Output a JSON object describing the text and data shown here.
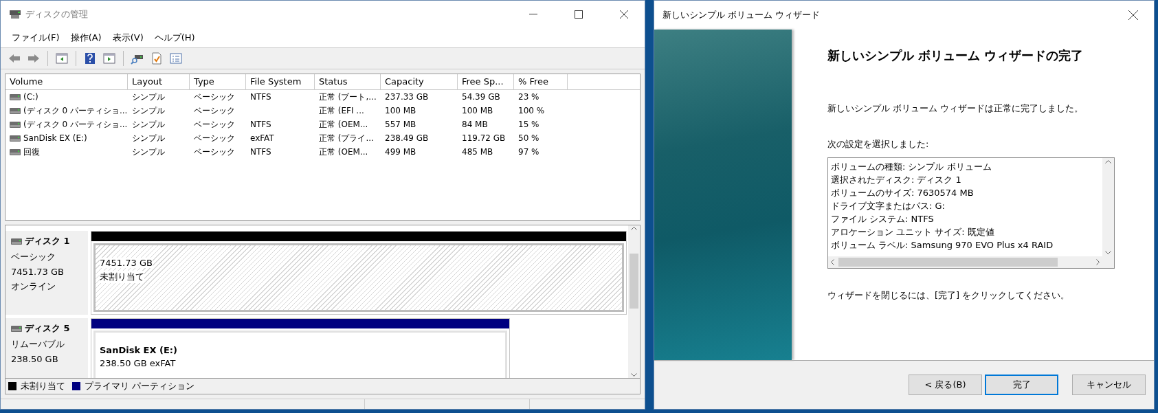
{
  "disk_management": {
    "title": "ディスクの管理",
    "menu": [
      "ファイル(F)",
      "操作(A)",
      "表示(V)",
      "ヘルプ(H)"
    ],
    "table": {
      "columns": [
        "Volume",
        "Layout",
        "Type",
        "File System",
        "Status",
        "Capacity",
        "Free Sp...",
        "% Free"
      ],
      "rows": [
        {
          "cells": [
            " (C:)",
            "シンプル",
            "ベーシック",
            "NTFS",
            "正常 (ブート,...",
            "237.33 GB",
            "54.39 GB",
            "23 %"
          ]
        },
        {
          "cells": [
            "(ディスク 0 パーティショ...",
            "シンプル",
            "ベーシック",
            "",
            "正常 (EFI ...",
            "100 MB",
            "100 MB",
            "100 %"
          ]
        },
        {
          "cells": [
            "(ディスク 0 パーティショ...",
            "シンプル",
            "ベーシック",
            "NTFS",
            "正常 (OEM...",
            "557 MB",
            "84 MB",
            "15 %"
          ]
        },
        {
          "cells": [
            "SanDisk EX (E:)",
            "シンプル",
            "ベーシック",
            "exFAT",
            "正常 (プライ...",
            "238.49 GB",
            "119.72 GB",
            "50 %"
          ]
        },
        {
          "cells": [
            "回復",
            "シンプル",
            "ベーシック",
            "NTFS",
            "正常 (OEM...",
            "499 MB",
            "485 MB",
            "97 %"
          ]
        }
      ]
    },
    "disks": [
      {
        "name": "ディスク 1",
        "lines": [
          "ベーシック",
          "7451.73 GB",
          "オンライン"
        ],
        "partitions": [
          {
            "kind": "unallocated",
            "color": "#000000",
            "lines": [
              "7451.73 GB",
              "未割り当て"
            ]
          }
        ]
      },
      {
        "name": "ディスク 5",
        "lines": [
          "リムーバブル",
          "238.50 GB"
        ],
        "partitions": [
          {
            "kind": "primary",
            "color": "#000080",
            "title": "SanDisk EX  (E:)",
            "lines": [
              "238.50 GB exFAT"
            ]
          }
        ]
      }
    ],
    "legend": [
      {
        "label": "未割り当て",
        "color": "#000000"
      },
      {
        "label": "プライマリ パーティション",
        "color": "#000080"
      }
    ]
  },
  "wizard": {
    "title": "新しいシンプル ボリューム ウィザード",
    "heading": "新しいシンプル ボリューム ウィザードの完了",
    "message": "新しいシンプル ボリューム ウィザードは正常に完了しました。",
    "settings_label": "次の設定を選択しました:",
    "settings": [
      "ボリュームの種類: シンプル ボリューム",
      "選択されたディスク: ディスク 1",
      "ボリュームのサイズ: 7630574 MB",
      "ドライブ文字またはパス: G:",
      "ファイル システム: NTFS",
      "アロケーション ユニット サイズ: 既定値",
      "ボリューム ラベル: Samsung 970 EVO Plus x4 RAID"
    ],
    "close_hint": "ウィザードを閉じるには、[完了] をクリックしてください。",
    "buttons": [
      {
        "label": "< 戻る(B)",
        "focused": false
      },
      {
        "label": "完了",
        "focused": true
      },
      {
        "label": "キャンセル",
        "focused": false
      }
    ]
  }
}
